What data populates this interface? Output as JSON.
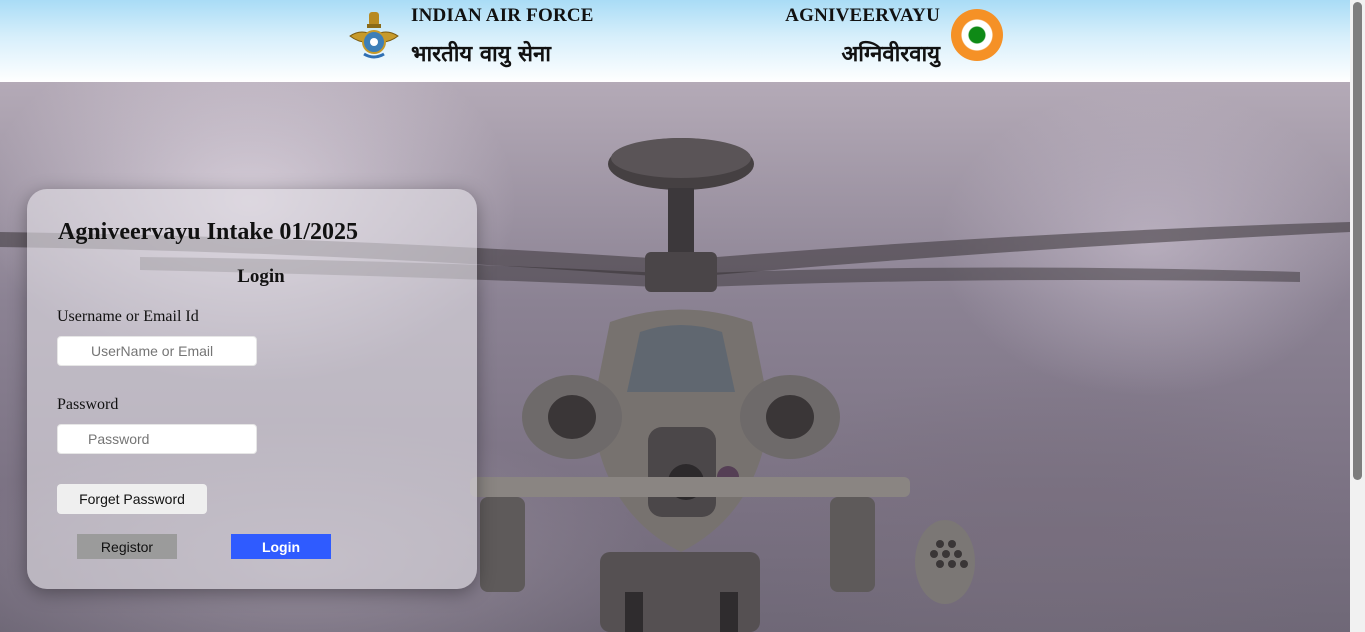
{
  "header": {
    "org_en": "INDIAN AIR FORCE",
    "org_hi": "भारतीय वायु सेना",
    "scheme_en": "AGNIVEERVAYU",
    "scheme_hi": "अग्निवीरवायु",
    "emblem_icon": "iaf-crest-icon",
    "roundel_icon": "iaf-roundel-icon",
    "roundel_colors": [
      "#f59126",
      "#ffffff",
      "#0f8a16"
    ]
  },
  "login": {
    "title": "Agniveervayu Intake 01/2025",
    "subtitle": "Login",
    "username_label": "Username or Email Id",
    "username_placeholder": "UserName or Email",
    "username_value": "",
    "password_label": "Password",
    "password_placeholder": "Password",
    "password_value": "",
    "forget_label": "Forget Password",
    "register_label": "Registor",
    "login_label": "Login"
  },
  "colors": {
    "login_button": "#2f5bff",
    "register_button": "#9b9b9b"
  }
}
